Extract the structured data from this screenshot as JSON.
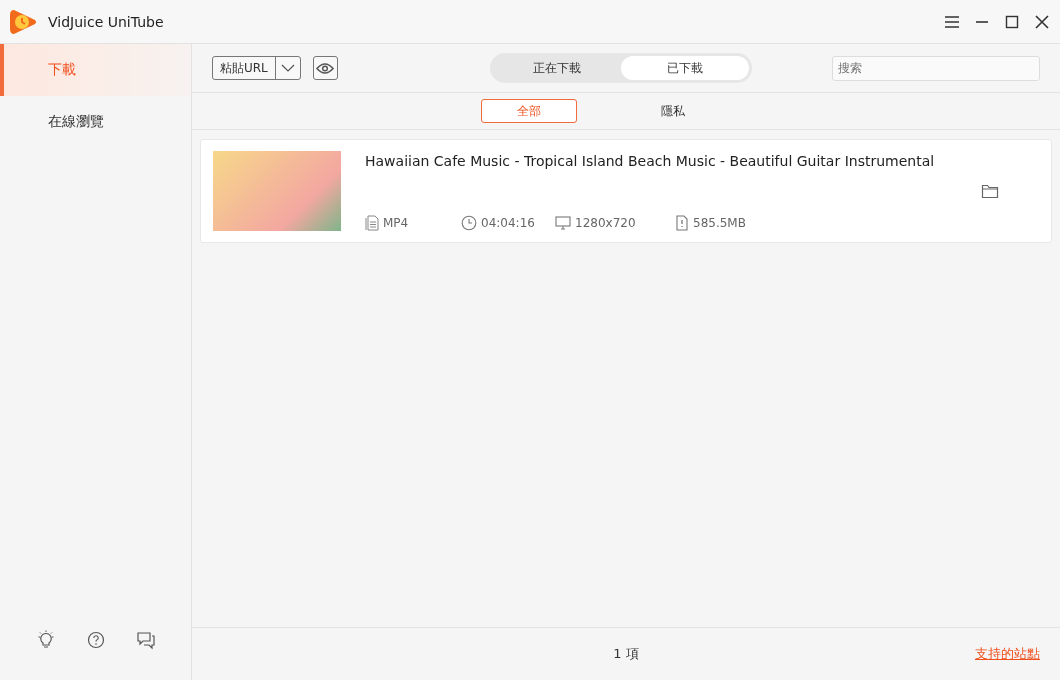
{
  "window": {
    "title": "VidJuice UniTube"
  },
  "sidebar": {
    "items": [
      {
        "label": "下載",
        "selected": true
      },
      {
        "label": "在線瀏覽",
        "selected": false
      }
    ]
  },
  "toolbar": {
    "paste_button": "粘貼URL",
    "search": {
      "placeholder": "搜索"
    }
  },
  "tabs": [
    {
      "label": "正在下載",
      "selected": false
    },
    {
      "label": "已下載",
      "selected": true
    }
  ],
  "filters": [
    {
      "label": "全部",
      "selected": true
    },
    {
      "label": "隱私",
      "selected": false
    }
  ],
  "downloads": [
    {
      "title": "Hawaiian Cafe Music - Tropical Island Beach Music - Beautiful Guitar Instrumental",
      "format": "MP4",
      "duration": "04:04:16",
      "resolution": "1280x720",
      "size": "585.5MB"
    }
  ],
  "status_bar": {
    "count": "1 項",
    "link": "支持的站點"
  }
}
